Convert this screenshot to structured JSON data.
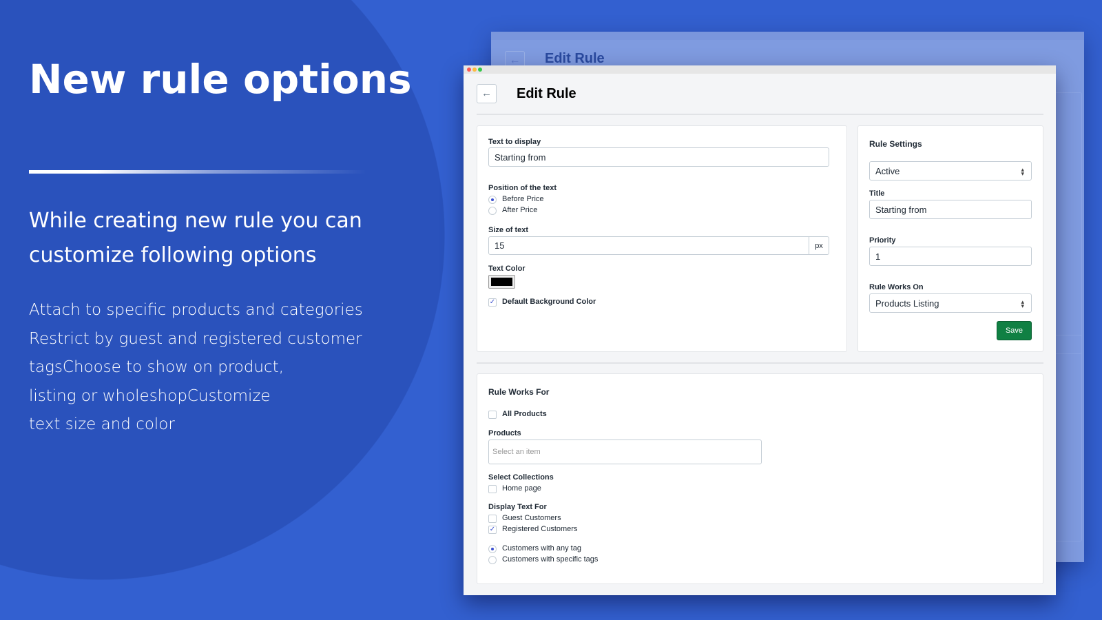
{
  "promo": {
    "title": "New rule options",
    "subtitle": "While creating new rule you can customize following options",
    "body_lines": [
      "Attach to specific products and categories",
      "Restrict by guest and registered customer",
      "tagsChoose to show on product,",
      "listing or wholeshopCustomize",
      "text size and color"
    ]
  },
  "colors": {
    "background": "#3360d0",
    "circle": "#2a52bc",
    "save_button": "#108043",
    "accent": "#3b4fd0"
  },
  "back_window": {
    "title": "Edit Rule"
  },
  "window": {
    "title": "Edit Rule",
    "back_icon": "arrow-left-icon",
    "display_card": {
      "text_label": "Text to display",
      "text_value": "Starting from",
      "position_label": "Position of the text",
      "position_options": [
        "Before Price",
        "After Price"
      ],
      "position_selected": "Before Price",
      "size_label": "Size of text",
      "size_value": "15",
      "size_unit": "px",
      "color_label": "Text Color",
      "color_value": "#000000",
      "default_bg_label": "Default Background Color",
      "default_bg_checked": true
    },
    "settings_card": {
      "heading": "Rule Settings",
      "status_value": "Active",
      "title_label": "Title",
      "title_value": "Starting from",
      "priority_label": "Priority",
      "priority_value": "1",
      "works_on_label": "Rule Works On",
      "works_on_value": "Products Listing",
      "save_label": "Save"
    },
    "works_for_card": {
      "heading": "Rule Works For",
      "all_products_label": "All Products",
      "all_products_checked": false,
      "products_label": "Products",
      "products_placeholder": "Select an item",
      "collections_label": "Select Collections",
      "collections": [
        {
          "label": "Home page",
          "checked": false
        }
      ],
      "display_for_label": "Display Text For",
      "customer_types": [
        {
          "label": "Guest Customers",
          "checked": false
        },
        {
          "label": "Registered Customers",
          "checked": true
        }
      ],
      "tag_options": [
        "Customers with any tag",
        "Customers with specific tags"
      ],
      "tag_selected": "Customers with any tag"
    }
  }
}
